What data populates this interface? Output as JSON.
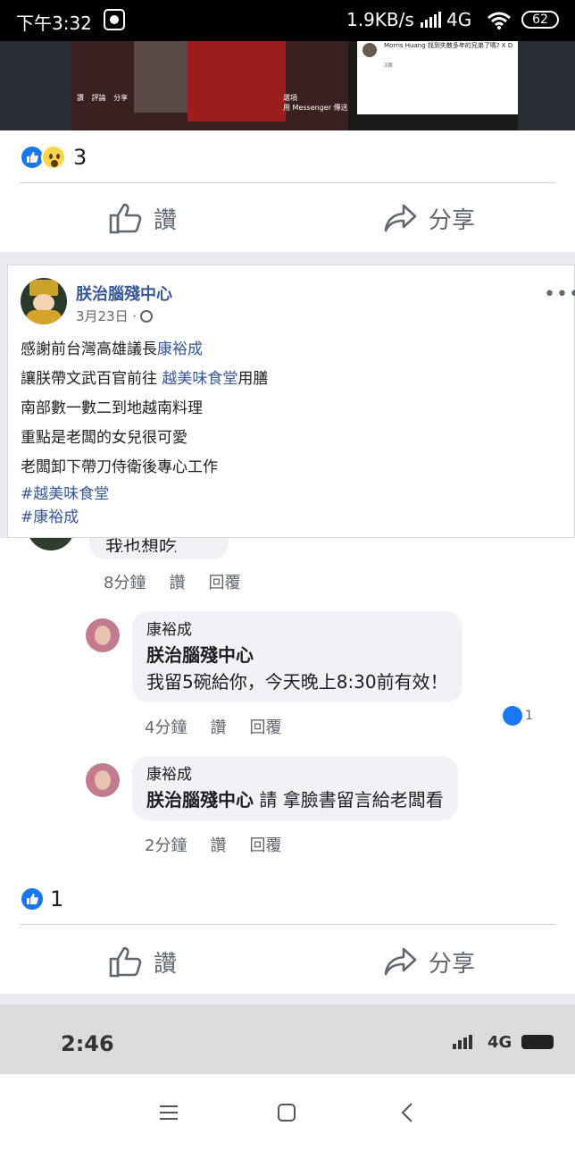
{
  "status_bar": {
    "time": "下午3:32",
    "network_speed": "1.9KB/s",
    "network_type": "4G",
    "battery": "62"
  },
  "embed": {
    "actions": [
      "讚",
      "評論",
      "分享"
    ],
    "right_actions": [
      "選項",
      "用 Messenger 傳送"
    ],
    "comment_text": "Morris Huang 找到失散多年的兄弟了嗎? X D",
    "comment_time": "3周"
  },
  "post1": {
    "reaction_count": "3",
    "like_label": "讚",
    "share_label": "分享"
  },
  "post2": {
    "author": "朕治腦殘中心",
    "date": "3月23日 ·",
    "lines": [
      {
        "pre": "感謝前台灣高雄議長",
        "link": "康裕成",
        "post": ""
      },
      {
        "pre": "讓朕帶文武百官前往 ",
        "link": "越美味食堂",
        "post": "用膳"
      },
      {
        "pre": "南部數一數二到地越南料理",
        "link": "",
        "post": ""
      },
      {
        "pre": "重點是老闆的女兒很可愛",
        "link": "",
        "post": ""
      },
      {
        "pre": "老闆卸下帶刀侍衛後專心工作",
        "link": "",
        "post": ""
      }
    ],
    "hashtags": [
      "#越美味食堂",
      "#康裕成"
    ],
    "reaction_count": "1",
    "like_label": "讚",
    "share_label": "分享"
  },
  "comments": {
    "partial_text": "我也想吃",
    "partial_meta": {
      "time": "8分鐘",
      "like": "讚",
      "reply": "回覆"
    },
    "replies": [
      {
        "name": "康裕成",
        "mention": "朕治腦殘中心",
        "text": "我留5碗給你，今天晚上8:30前有效！",
        "time": "4分鐘",
        "like": "讚",
        "reply": "回覆",
        "like_count": "1"
      },
      {
        "name": "康裕成",
        "mention": "朕治腦殘中心",
        "text": " 請 拿臉書留言給老闆看",
        "time": "2分鐘",
        "like": "讚",
        "reply": "回覆"
      }
    ]
  },
  "strip": {
    "time": "2:46",
    "network_type": "4G"
  },
  "colors": {
    "link": "#385898",
    "facebook_blue": "#1877f2",
    "muted": "#606770"
  }
}
